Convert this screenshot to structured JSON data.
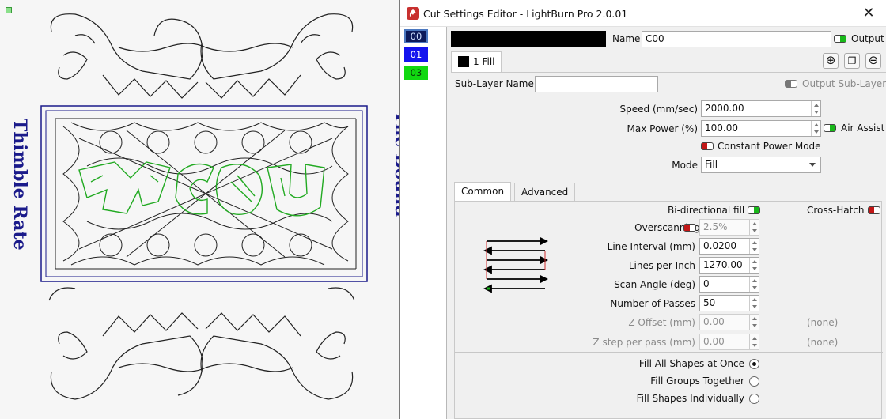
{
  "window": {
    "title": "Cut Settings Editor - LightBurn Pro 2.0.01"
  },
  "layers": [
    "00",
    "01",
    "03"
  ],
  "layer_colors": {
    "00": "#0c1a5a",
    "01": "#1414ee",
    "03": "#11d811"
  },
  "name_row": {
    "label": "Name",
    "value": "C00",
    "output_label": "Output"
  },
  "sublayer_tab": {
    "label": "1 Fill"
  },
  "sublayer": {
    "label": "Sub-Layer Name",
    "value": "",
    "output_sublayer_label": "Output Sub-Layer"
  },
  "speed": {
    "label": "Speed (mm/sec)",
    "value": "2000.00"
  },
  "max_power": {
    "label": "Max Power (%)",
    "value": "100.00"
  },
  "air_assist": {
    "label": "Air Assist"
  },
  "constant_power": {
    "label": "Constant Power Mode"
  },
  "mode": {
    "label": "Mode",
    "value": "Fill"
  },
  "tabs": {
    "common": "Common",
    "advanced": "Advanced"
  },
  "bidirectional": {
    "label": "Bi-directional fill"
  },
  "crosshatch": {
    "label": "Cross-Hatch"
  },
  "overscanning": {
    "label": "Overscanning",
    "value": "2.5%"
  },
  "line_interval": {
    "label": "Line Interval (mm)",
    "value": "0.0200"
  },
  "lines_per_inch": {
    "label": "Lines per Inch",
    "value": "1270.00"
  },
  "scan_angle": {
    "label": "Scan Angle (deg)",
    "value": "0"
  },
  "passes": {
    "label": "Number of Passes",
    "value": "50"
  },
  "z_offset": {
    "label": "Z Offset (mm)",
    "value": "0.00",
    "note": "(none)"
  },
  "z_step": {
    "label": "Z step per pass (mm)",
    "value": "0.00",
    "note": "(none)"
  },
  "fill_options": [
    {
      "label": "Fill All Shapes at Once",
      "checked": true
    },
    {
      "label": "Fill Groups Together",
      "checked": false
    },
    {
      "label": "Fill Shapes Individually",
      "checked": false
    }
  ],
  "canvas": {
    "center_text": "MCOU",
    "left_side_text": "Thimble Rate",
    "right_side_text": "The Bound",
    "colors": {
      "art": "#1b1b1b",
      "border": "#1a1a8a",
      "green": "#22aa22"
    }
  }
}
